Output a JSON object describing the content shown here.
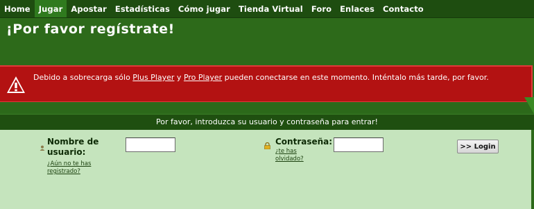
{
  "nav": {
    "items": [
      {
        "label": "Home",
        "active": false
      },
      {
        "label": "Jugar",
        "active": true
      },
      {
        "label": "Apostar",
        "active": false
      },
      {
        "label": "Estadísticas",
        "active": false
      },
      {
        "label": "Cómo jugar",
        "active": false
      },
      {
        "label": "Tienda Virtual",
        "active": false
      },
      {
        "label": "Foro",
        "active": false
      },
      {
        "label": "Enlaces",
        "active": false
      },
      {
        "label": "Contacto",
        "active": false
      }
    ]
  },
  "page": {
    "title": "¡Por favor regístrate!"
  },
  "warning": {
    "icon": "warning-triangle-icon",
    "text_before": "Debido a sobrecarga sólo ",
    "link1": "Plus Player",
    "text_mid": " y ",
    "link2": "Pro Player",
    "text_after": " pueden conectarse en este momento. Inténtalo más tarde, por favor."
  },
  "login": {
    "instruction": "Por favor, introduzca su usuario y contraseña para entrar!",
    "username_label": "Nombre de usuario:",
    "username_link": "¿Aún no te has registrado?",
    "username_value": "",
    "password_label": "Contraseña:",
    "password_link": "¿te has olvidado?",
    "password_value": "",
    "submit_label": ">> Login"
  },
  "colors": {
    "nav_bg": "#1e4d10",
    "nav_active": "#2f7a1e",
    "page_bg": "#2d6a1a",
    "warning_bg": "#b31212",
    "login_bg": "#c5e4bd"
  }
}
